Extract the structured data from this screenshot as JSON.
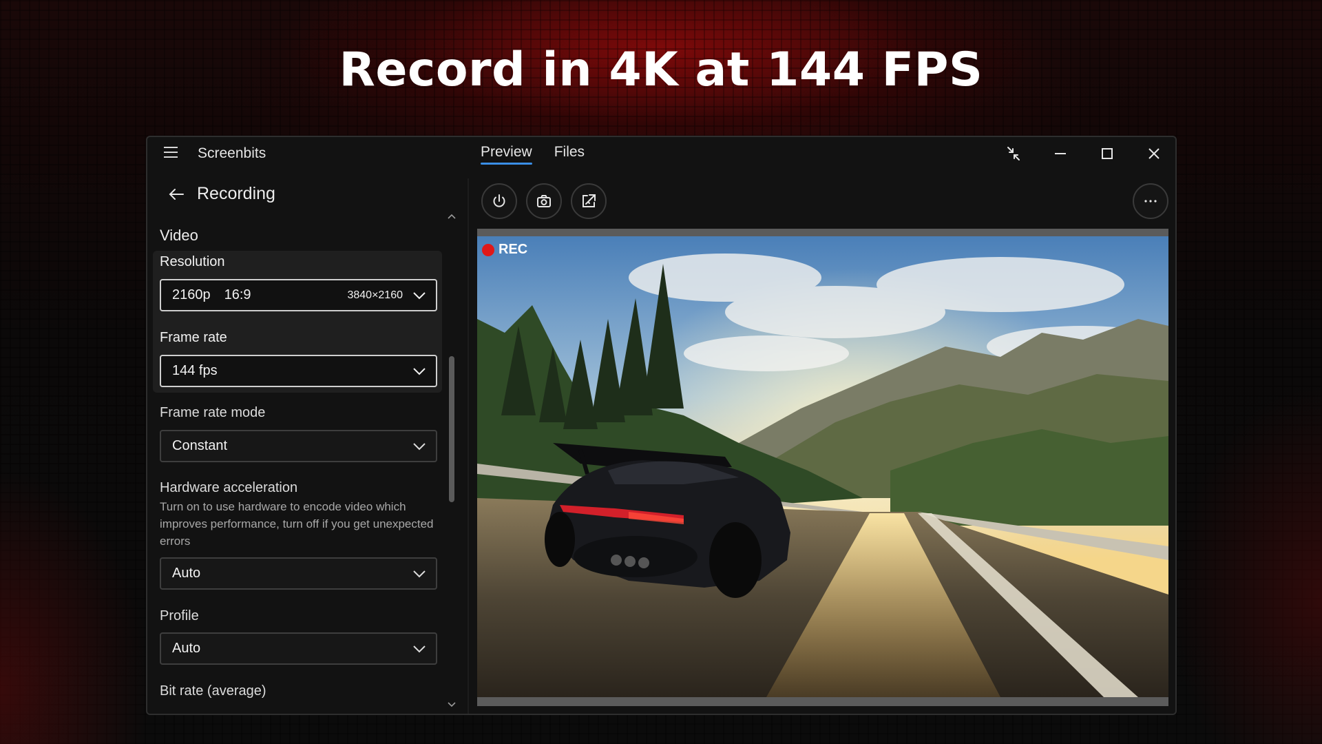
{
  "headline": "Record in 4K at 144 FPS",
  "app": {
    "name": "Screenbits",
    "tabs": [
      {
        "label": "Preview",
        "active": true
      },
      {
        "label": "Files",
        "active": false
      }
    ]
  },
  "page": {
    "title": "Recording",
    "section": "Video"
  },
  "settings": {
    "resolution": {
      "label": "Resolution",
      "value": "2160p",
      "aspect": "16:9",
      "pixels": "3840×2160"
    },
    "frame_rate": {
      "label": "Frame rate",
      "value": "144 fps"
    },
    "frame_rate_mode": {
      "label": "Frame rate mode",
      "value": "Constant"
    },
    "hardware_acceleration": {
      "label": "Hardware acceleration",
      "description": "Turn on to use hardware to encode video which improves performance, turn off if you get unexpected errors",
      "value": "Auto"
    },
    "profile": {
      "label": "Profile",
      "value": "Auto"
    },
    "bit_rate": {
      "label": "Bit rate (average)"
    }
  },
  "preview": {
    "rec_label": "REC"
  },
  "colors": {
    "accent": "#3a8ee6",
    "rec": "#e01818",
    "window_bg": "#121212"
  },
  "icons": [
    "menu-icon",
    "back-arrow-icon",
    "compact-overlay-icon",
    "minimize-icon",
    "maximize-icon",
    "close-icon",
    "power-icon",
    "camera-icon",
    "popout-icon",
    "more-icon",
    "chevron-down-icon",
    "chevron-up-icon"
  ]
}
